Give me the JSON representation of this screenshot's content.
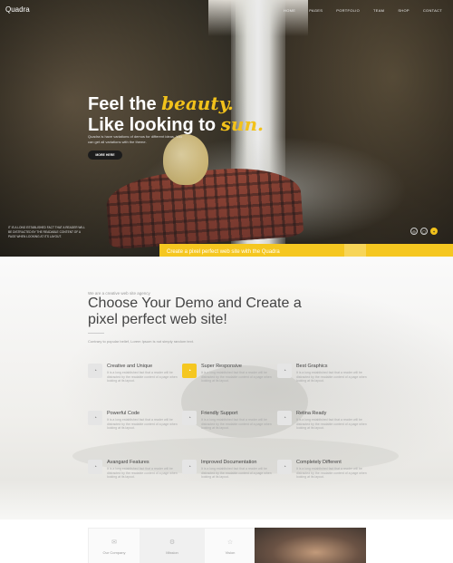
{
  "brand": "Quadra",
  "nav": [
    "HOME",
    "PAGES",
    "PORTFOLIO",
    "TEAM",
    "SHOP",
    "CONTACT"
  ],
  "hero": {
    "title_line1": "Feel the ",
    "title_accent1": "beauty.",
    "title_line2": "Like looking to ",
    "title_accent2": "sun.",
    "description": "Quadra is have variations of demos for different ideas. You can get all variations with the theme.",
    "button": "MORE HERE",
    "side_note": "It is a long established fact that a reader will be distracted by the readable content of a page when looking at its layout."
  },
  "social_icons": [
    "dribbble-icon",
    "instagram-icon",
    "twitter-icon"
  ],
  "promo": {
    "title": "Create a pixel perfect web site with the Quadra",
    "subtitle": "Contrary to popular belief, Lorem Ipsum is not simply random text."
  },
  "intro": {
    "kicker": "We are a creative web site agency",
    "headline": "Choose Your Demo and Create a pixel perfect web site!",
    "lede": "Contrary to popular belief, Lorem Ipsum is not simply random text."
  },
  "features": [
    {
      "title": "Creative and Unique",
      "text": "It is a long established fact that a reader will be distracted by the readable content of a page when looking at its layout.",
      "icon": "pie-icon",
      "active": false
    },
    {
      "title": "Super Responsive",
      "text": "It is a long established fact that a reader will be distracted by the readable content of a page when looking at its layout.",
      "icon": "pie-icon",
      "active": true
    },
    {
      "title": "Best Graphics",
      "text": "It is a long established fact that a reader will be distracted by the readable content of a page when looking at its layout.",
      "icon": "pie-icon",
      "active": false
    },
    {
      "title": "Powerful Code",
      "text": "It is a long established fact that a reader will be distracted by the readable content of a page when looking at its layout.",
      "icon": "pie-icon",
      "active": false
    },
    {
      "title": "Friendly Support",
      "text": "It is a long established fact that a reader will be distracted by the readable content of a page when looking at its layout.",
      "icon": "pie-icon",
      "active": false
    },
    {
      "title": "Retina Ready",
      "text": "It is a long established fact that a reader will be distracted by the readable content of a page when looking at its layout.",
      "icon": "pie-icon",
      "active": false
    },
    {
      "title": "Avangard Features",
      "text": "It is a long established fact that a reader will be distracted by the readable content of a page when looking at its layout.",
      "icon": "pie-icon",
      "active": false
    },
    {
      "title": "Improved Documentation",
      "text": "It is a long established fact that a reader will be distracted by the readable content of a page when looking at its layout.",
      "icon": "pie-icon",
      "active": false
    },
    {
      "title": "Completely Different",
      "text": "It is a long established fact that a reader will be distracted by the readable content of a page when looking at its layout.",
      "icon": "pie-icon",
      "active": false
    }
  ],
  "tabs": [
    {
      "label": "Our Company",
      "icon": "envelope-icon",
      "active": false
    },
    {
      "label": "Mission",
      "icon": "gear-icon",
      "active": true
    },
    {
      "label": "Vision",
      "icon": "star-icon",
      "active": false
    }
  ],
  "colors": {
    "accent": "#f5c720",
    "dark": "#1c1c1c"
  }
}
